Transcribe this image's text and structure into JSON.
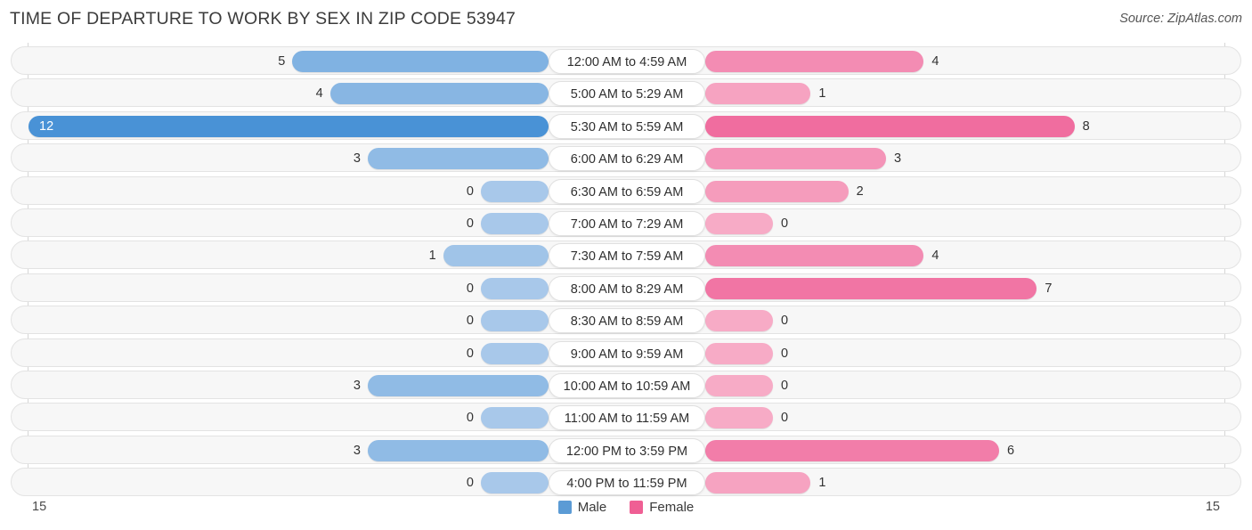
{
  "header": {
    "title": "TIME OF DEPARTURE TO WORK BY SEX IN ZIP CODE 53947",
    "source": "Source: ZipAtlas.com"
  },
  "footer": {
    "axis_left": "15",
    "axis_right": "15",
    "legend": [
      {
        "label": "Male",
        "color": "#5b9bd5"
      },
      {
        "label": "Female",
        "color": "#ef5f94"
      }
    ]
  },
  "chart_data": {
    "type": "bar",
    "orientation": "horizontal-diverging",
    "title": "TIME OF DEPARTURE TO WORK BY SEX IN ZIP CODE 53947",
    "xlabel": "",
    "ylabel": "",
    "xlim": [
      15,
      15
    ],
    "grid": false,
    "legend_position": "bottom-center",
    "categories": [
      "12:00 AM to 4:59 AM",
      "5:00 AM to 5:29 AM",
      "5:30 AM to 5:59 AM",
      "6:00 AM to 6:29 AM",
      "6:30 AM to 6:59 AM",
      "7:00 AM to 7:29 AM",
      "7:30 AM to 7:59 AM",
      "8:00 AM to 8:29 AM",
      "8:30 AM to 8:59 AM",
      "9:00 AM to 9:59 AM",
      "10:00 AM to 10:59 AM",
      "11:00 AM to 11:59 AM",
      "12:00 PM to 3:59 PM",
      "4:00 PM to 11:59 PM"
    ],
    "series": [
      {
        "name": "Male",
        "side": "left",
        "color": "#5b9bd5",
        "values": [
          5,
          4,
          12,
          3,
          0,
          0,
          1,
          0,
          0,
          0,
          3,
          0,
          3,
          0
        ]
      },
      {
        "name": "Female",
        "side": "right",
        "color": "#ef5f94",
        "values": [
          4,
          1,
          8,
          3,
          2,
          0,
          4,
          7,
          0,
          0,
          0,
          0,
          6,
          1
        ]
      }
    ]
  }
}
